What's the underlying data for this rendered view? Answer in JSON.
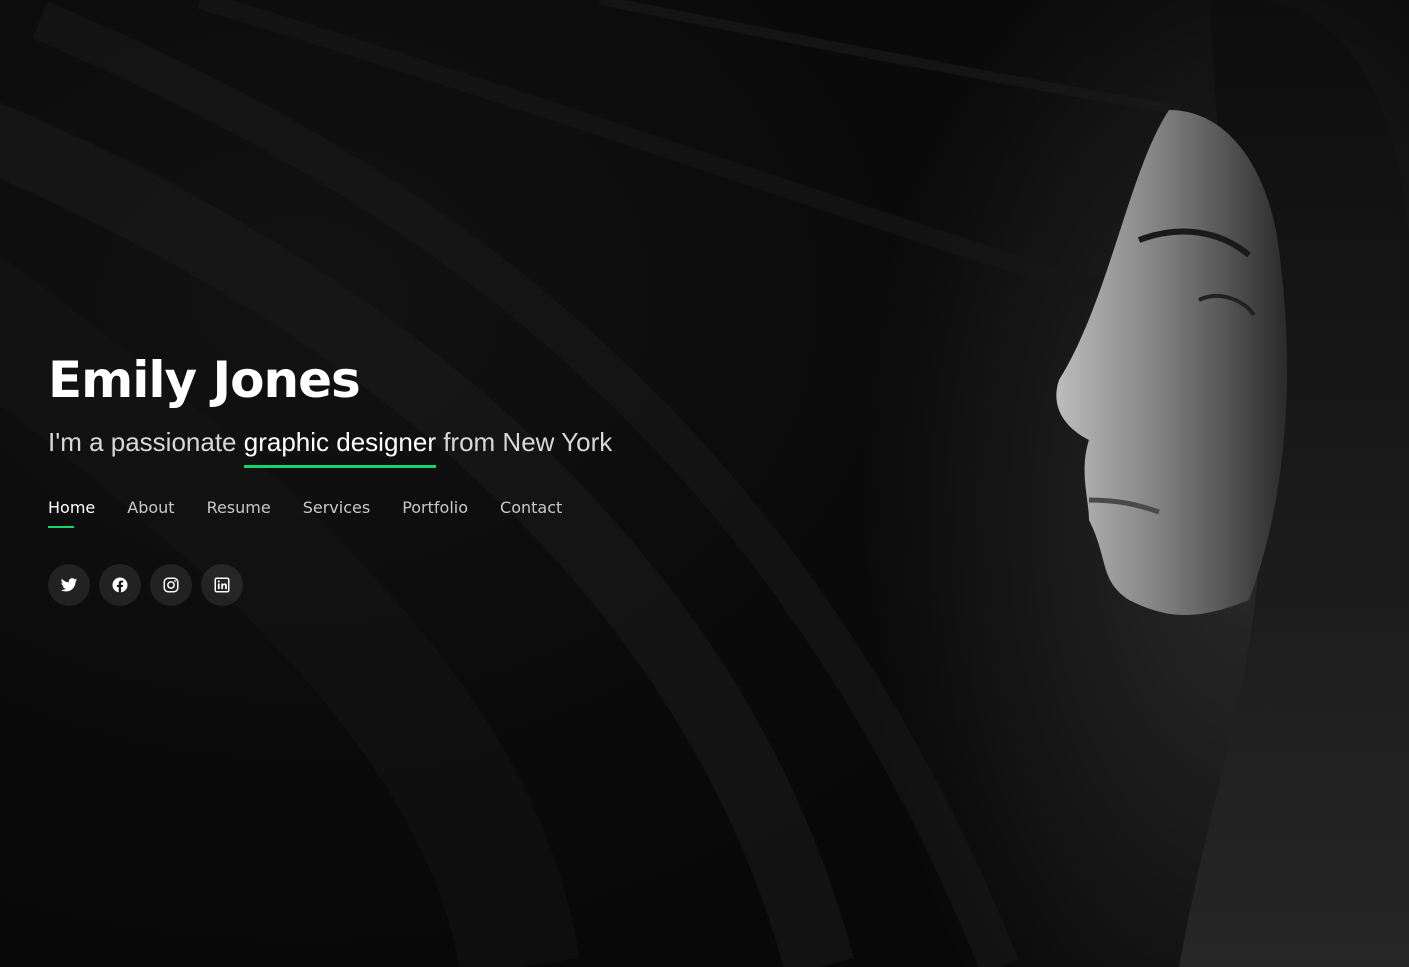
{
  "hero": {
    "name": "Emily Jones",
    "tagline_prefix": "I'm a passionate ",
    "tagline_highlight": "graphic designer",
    "tagline_suffix": " from New York"
  },
  "nav": {
    "items": [
      {
        "label": "Home",
        "active": true
      },
      {
        "label": "About"
      },
      {
        "label": "Resume"
      },
      {
        "label": "Services"
      },
      {
        "label": "Portfolio"
      },
      {
        "label": "Contact"
      }
    ]
  },
  "social": {
    "icons": [
      "twitter-icon",
      "facebook-icon",
      "instagram-icon",
      "linkedin-icon"
    ]
  },
  "colors": {
    "accent": "#18d26e",
    "background": "#0a0a0a",
    "text": "#ffffff",
    "muted_text": "#c9c9c9"
  }
}
